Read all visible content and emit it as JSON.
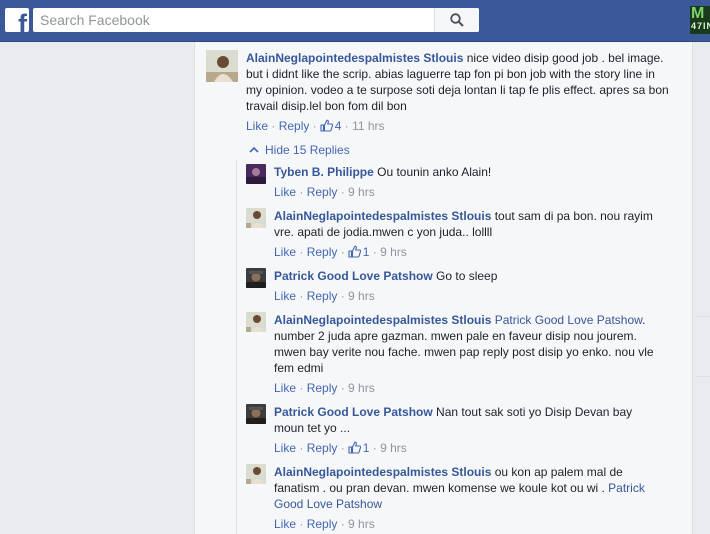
{
  "header": {
    "logo_letter": "f",
    "search_placeholder": "Search Facebook",
    "badge_line1": "M",
    "badge_line2": "47IN"
  },
  "main_comment": {
    "author": "AlainNeglapointedespalmistes Stlouis",
    "lines": [
      " nice video disip good job . bel image.",
      "but i didnt like the scrip. abias laguerre tap fon pi bon job with the story line in",
      "my opinion. vodeo a te surpose soti deja lontan li tap fe plis effect. apres sa bon",
      "travail disip.lel bon fom dil bon"
    ],
    "like_label": "Like",
    "reply_label": "Reply",
    "likes": "4",
    "time": "11 hrs"
  },
  "hide_replies_label": "Hide 15 Replies",
  "replies": [
    {
      "author": "Tyben B. Philippe",
      "lines": [
        " Ou tounin anko Alain!"
      ],
      "like_label": "Like",
      "reply_label": "Reply",
      "likes": "",
      "time": "9 hrs",
      "avatar": "purple"
    },
    {
      "author": "AlainNeglapointedespalmistes Stlouis",
      "lines": [
        " tout sam di pa bon. nou rayim",
        "vre. apati de jodia.mwen c yon juda.. lollll"
      ],
      "like_label": "Like",
      "reply_label": "Reply",
      "likes": "1",
      "time": "9 hrs",
      "avatar": "alain"
    },
    {
      "author": "Patrick Good Love Patshow",
      "lines": [
        " Go to sleep"
      ],
      "like_label": "Like",
      "reply_label": "Reply",
      "likes": "",
      "time": "9 hrs",
      "avatar": "patrick"
    },
    {
      "author": "AlainNeglapointedespalmistes Stlouis",
      "mention": " Patrick Good Love Patshow",
      "lines": [
        ".",
        "number 2 juda apre gazman. mwen pale en faveur disip nou jourem.",
        "mwen bay verite nou fache. mwen pap reply post disip yo enko. nou vle",
        "fem edmi"
      ],
      "like_label": "Like",
      "reply_label": "Reply",
      "likes": "",
      "time": "9 hrs",
      "avatar": "alain"
    },
    {
      "author": "Patrick Good Love Patshow",
      "lines": [
        " Nan tout sak soti yo Disip Devan bay",
        "moun tet yo ..."
      ],
      "like_label": "Like",
      "reply_label": "Reply",
      "likes": "1",
      "time": "9 hrs",
      "avatar": "patrick"
    },
    {
      "author": "AlainNeglapointedespalmistes Stlouis",
      "lines": [
        " ou kon ap palem mal de",
        "fanatism . ou pran devan. mwen komense we koule kot ou wi . "
      ],
      "mention2_part1": "Patrick",
      "mention2_part2": "Good Love Patshow",
      "like_label": "Like",
      "reply_label": "Reply",
      "likes": "",
      "time": "9 hrs",
      "avatar": "alain"
    }
  ],
  "colors": {
    "brand": "#3b5998",
    "link": "#365899",
    "meta": "#90949c",
    "bg": "#e9ebee"
  }
}
